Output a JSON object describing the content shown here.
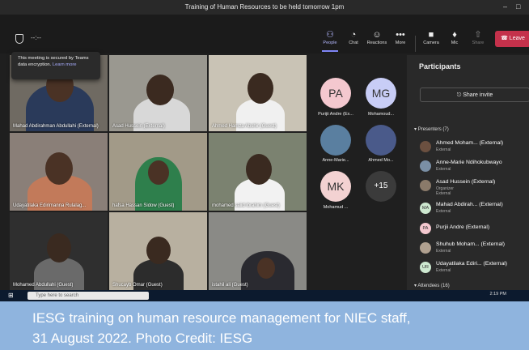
{
  "window": {
    "title": "Training of Human Resources to be held tomorrow 1pm",
    "minimize": "–",
    "maximize": "□"
  },
  "toolbar": {
    "timer": "--:--",
    "buttons": [
      {
        "label": "People",
        "icon": "people-icon",
        "glyph": "⚇"
      },
      {
        "label": "Chat",
        "icon": "chat-icon",
        "glyph": "◔"
      },
      {
        "label": "Reactions",
        "icon": "reactions-icon",
        "glyph": "☺"
      },
      {
        "label": "More",
        "icon": "more-icon",
        "glyph": "•••"
      },
      {
        "label": "Camera",
        "icon": "camera-icon",
        "glyph": "■"
      },
      {
        "label": "Mic",
        "icon": "mic-icon",
        "glyph": "♦"
      },
      {
        "label": "Share",
        "icon": "share-icon",
        "glyph": "⇧"
      }
    ],
    "leave_label": "Leave",
    "leave_color": "#c4314b"
  },
  "security_tooltip": {
    "text": "This meeting is secured by Teams data encryption.",
    "link": "Learn more"
  },
  "video_tiles": [
    {
      "name": "Mahad Abdirahman Abdullahi (External)"
    },
    {
      "name": "Asad Hussein (External)"
    },
    {
      "name": "Ahmed Hamza Abshir (Guest)"
    },
    {
      "name": "Udayatilaka Edirimanna Rulalag..."
    },
    {
      "name": "hafsa Hassan Sidow (Guest)"
    },
    {
      "name": "mohamed saiid ibrahim (Guest)"
    },
    {
      "name": "Mohamed Abdullahi (Guest)"
    },
    {
      "name": "Shucayb Omar (Guest)"
    },
    {
      "name": "istahil ali (Guest)"
    },
    {
      "name": ""
    }
  ],
  "mid_avatars": [
    {
      "initials": "PA",
      "label": "Purijii Andre (Ex...",
      "color": "#f4c8cf"
    },
    {
      "initials": "MG",
      "label": "Mohamoud...",
      "color": "#c8cdf6"
    },
    {
      "initials": "",
      "label": "Anne-Marie...",
      "color": "#5a7fa0"
    },
    {
      "initials": "",
      "label": "Ahmed Mo...",
      "color": "#4a5a8a"
    },
    {
      "initials": "MK",
      "label": "Mohamud ...",
      "color": "#f3d2d2"
    },
    {
      "initials": "+15",
      "label": "",
      "color": "#3b3b3b"
    }
  ],
  "participants": {
    "title": "Participants",
    "share_invite": "Share invite",
    "presenters_header": "Presenters (7)",
    "attendees_header": "Attendees (16)",
    "presenters": [
      {
        "name": "Ahmed Moham...  (External)",
        "role": "External",
        "initials": "",
        "color": "#6b5040"
      },
      {
        "name": "Anne-Marie Ndihokubwayo",
        "role": "External",
        "initials": "",
        "color": "#7a8fa5"
      },
      {
        "name": "Asad Hussein (External)",
        "role": "Organizer\nExternal",
        "initials": "",
        "color": "#8a7a6a"
      },
      {
        "name": "Mahad Abdirah...  (External)",
        "role": "External",
        "initials": "MA",
        "color": "#cde8d0"
      },
      {
        "name": "Purjii Andre (External)",
        "role": "",
        "initials": "PA",
        "color": "#f4c8cf"
      },
      {
        "name": "Shuhub Moham...  (External)",
        "role": "External",
        "initials": "",
        "color": "#b0a090"
      },
      {
        "name": "Udayatilaka Ediri...  (External)",
        "role": "External",
        "initials": "UR",
        "color": "#cde8d0"
      }
    ]
  },
  "taskbar": {
    "search_placeholder": "Type here to search",
    "clock": "2:19 PM"
  },
  "caption": {
    "line1": "IESG training on human resource management for NIEC staff,",
    "line2": "31 August 2022. Photo Credit: IESG"
  }
}
